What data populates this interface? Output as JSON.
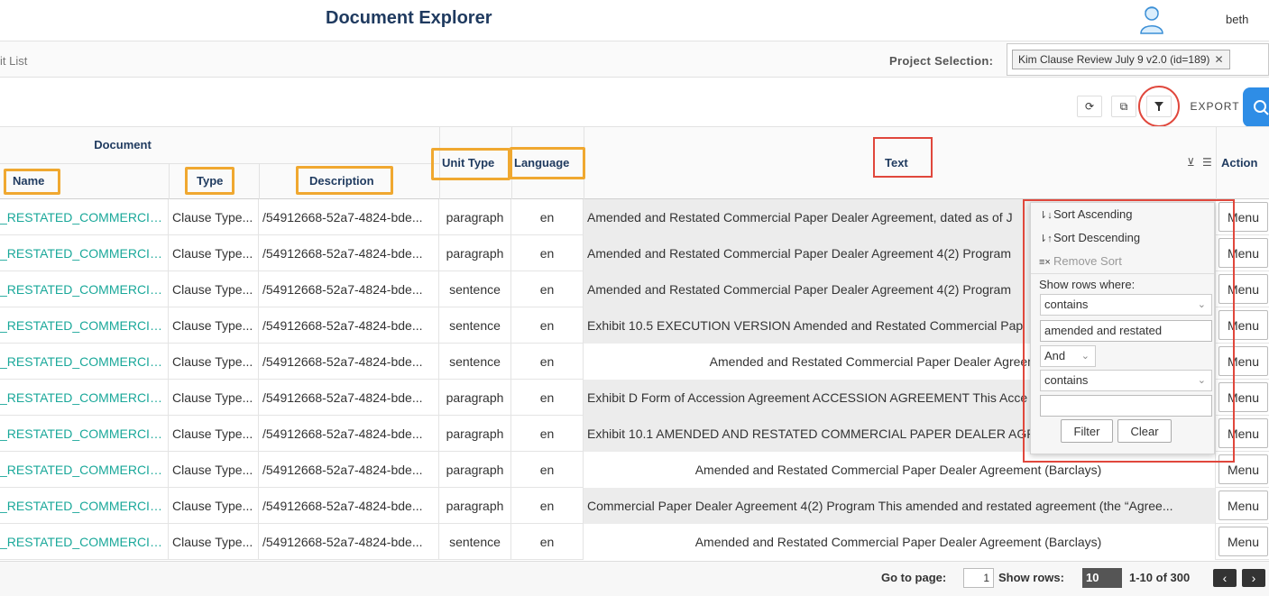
{
  "header": {
    "title": "Document Explorer",
    "user_name": "beth"
  },
  "subbar": {
    "breadcrumb": "it List",
    "project_label": "Project Selection:",
    "project_chip": "Kim Clause Review July 9 v2.0 (id=189)"
  },
  "toolbar": {
    "export_label": "EXPORT"
  },
  "table": {
    "group_header": "Document",
    "columns": {
      "name": "Name",
      "type": "Type",
      "description": "Description",
      "unit_type": "Unit Type",
      "language": "Language",
      "text": "Text",
      "action": "Action"
    },
    "rows": [
      {
        "name": "_RESTATED_COMMERCIAL...",
        "type": "Clause Type...",
        "description": "/54912668-52a7-4824-bde...",
        "unit_type": "paragraph",
        "language": "en",
        "text": "Amended and Restated Commercial Paper Dealer Agreement, dated as of J",
        "action": "Menu"
      },
      {
        "name": "_RESTATED_COMMERCIAL...",
        "type": "Clause Type...",
        "description": "/54912668-52a7-4824-bde...",
        "unit_type": "paragraph",
        "language": "en",
        "text": "Amended and Restated Commercial Paper Dealer Agreement 4(2) Program",
        "action": "Menu"
      },
      {
        "name": "_RESTATED_COMMERCIAL...",
        "type": "Clause Type...",
        "description": "/54912668-52a7-4824-bde...",
        "unit_type": "sentence",
        "language": "en",
        "text": "Amended and Restated Commercial Paper Dealer Agreement 4(2) Program",
        "action": "Menu"
      },
      {
        "name": "_RESTATED_COMMERCIAL...",
        "type": "Clause Type...",
        "description": "/54912668-52a7-4824-bde...",
        "unit_type": "sentence",
        "language": "en",
        "text": "Exhibit 10.5 EXECUTION VERSION Amended and Restated Commercial Pap",
        "action": "Menu"
      },
      {
        "name": "_RESTATED_COMMERCIAL...",
        "type": "Clause Type...",
        "description": "/54912668-52a7-4824-bde...",
        "unit_type": "sentence",
        "language": "en",
        "text": "Amended and Restated Commercial Paper Dealer Agreement, date",
        "action": "Menu",
        "centered": true
      },
      {
        "name": "_RESTATED_COMMERCIAL...",
        "type": "Clause Type...",
        "description": "/54912668-52a7-4824-bde...",
        "unit_type": "paragraph",
        "language": "en",
        "text": "Exhibit D Form of Accession Agreement ACCESSION AGREEMENT This Acce",
        "action": "Menu"
      },
      {
        "name": "_RESTATED_COMMERCIAL...",
        "type": "Clause Type...",
        "description": "/54912668-52a7-4824-bde...",
        "unit_type": "paragraph",
        "language": "en",
        "text": "Exhibit 10.1 AMENDED AND RESTATED COMMERCIAL PAPER DEALER AGRE",
        "action": "Menu"
      },
      {
        "name": "_RESTATED_COMMERCIAL...",
        "type": "Clause Type...",
        "description": "/54912668-52a7-4824-bde...",
        "unit_type": "paragraph",
        "language": "en",
        "text": "Amended and Restated Commercial Paper Dealer Agreement (Barclays)",
        "action": "Menu",
        "centered": true
      },
      {
        "name": "_RESTATED_COMMERCIAL...",
        "type": "Clause Type...",
        "description": "/54912668-52a7-4824-bde...",
        "unit_type": "paragraph",
        "language": "en",
        "text": "Commercial Paper Dealer Agreement 4(2) Program This amended and restated agreement (the “Agree...",
        "action": "Menu"
      },
      {
        "name": "_RESTATED_COMMERCIAL...",
        "type": "Clause Type...",
        "description": "/54912668-52a7-4824-bde...",
        "unit_type": "sentence",
        "language": "en",
        "text": "Amended and Restated Commercial Paper Dealer Agreement (Barclays)",
        "action": "Menu",
        "centered": true
      }
    ]
  },
  "filter_popup": {
    "sort_ascending": "Sort Ascending",
    "sort_descending": "Sort Descending",
    "remove_sort": "Remove Sort",
    "show_rows_where": "Show rows where:",
    "operator_1": "contains",
    "value_1": "amended and restated",
    "logic": "And",
    "operator_2": "contains",
    "value_2": "",
    "filter_button": "Filter",
    "clear_button": "Clear"
  },
  "footer": {
    "goto_label": "Go to page:",
    "goto_value": "1",
    "rows_label": "Show rows:",
    "rows_value": "10",
    "range": "1-10 of 300"
  },
  "colors": {
    "link_teal": "#1aa89a",
    "highlight_orange": "#f0a830",
    "annotation_red": "#e0473c",
    "header_navy": "#1f3a5f",
    "accent_blue": "#2e8de6"
  }
}
